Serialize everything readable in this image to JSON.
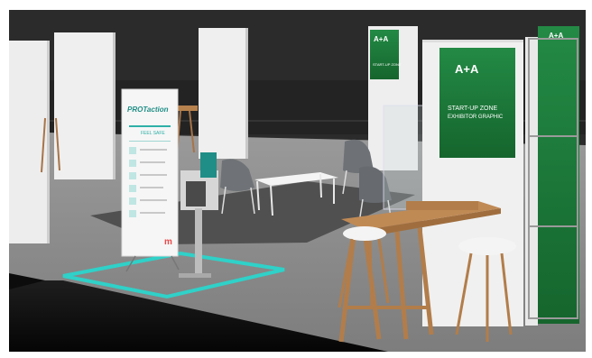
{
  "scene": {
    "type": "3d-rendering",
    "subject": "trade fair start-up zone booth",
    "colors": {
      "wall_dark": "#2a2a2a",
      "floor_grey": "#8f8f8f",
      "carpet_dark": "#4d4d4d",
      "column_white": "#efefef",
      "brand_green": "#1d7a3a",
      "teal_marking": "#2fd1c8",
      "wood": "#b7824d",
      "stage_black": "#111111",
      "seat_white": "#f4f4f4",
      "chair_grey": "#6f7377"
    }
  },
  "panels": {
    "main_logo": "A+A",
    "main_subtitle": "START-UP ZONE",
    "main_caption": "EXHIBITOR GRAPHIC",
    "small_logo": "A+A",
    "small_subtitle": "START-UP ZONE",
    "right_logo": "A+A"
  },
  "rollup_banner": {
    "brand": "PROTaction",
    "heading": "FEEL SAFE",
    "footer_logo": "m"
  },
  "icons": [
    "brand-logo-icon",
    "rollup-m-logo-icon"
  ]
}
